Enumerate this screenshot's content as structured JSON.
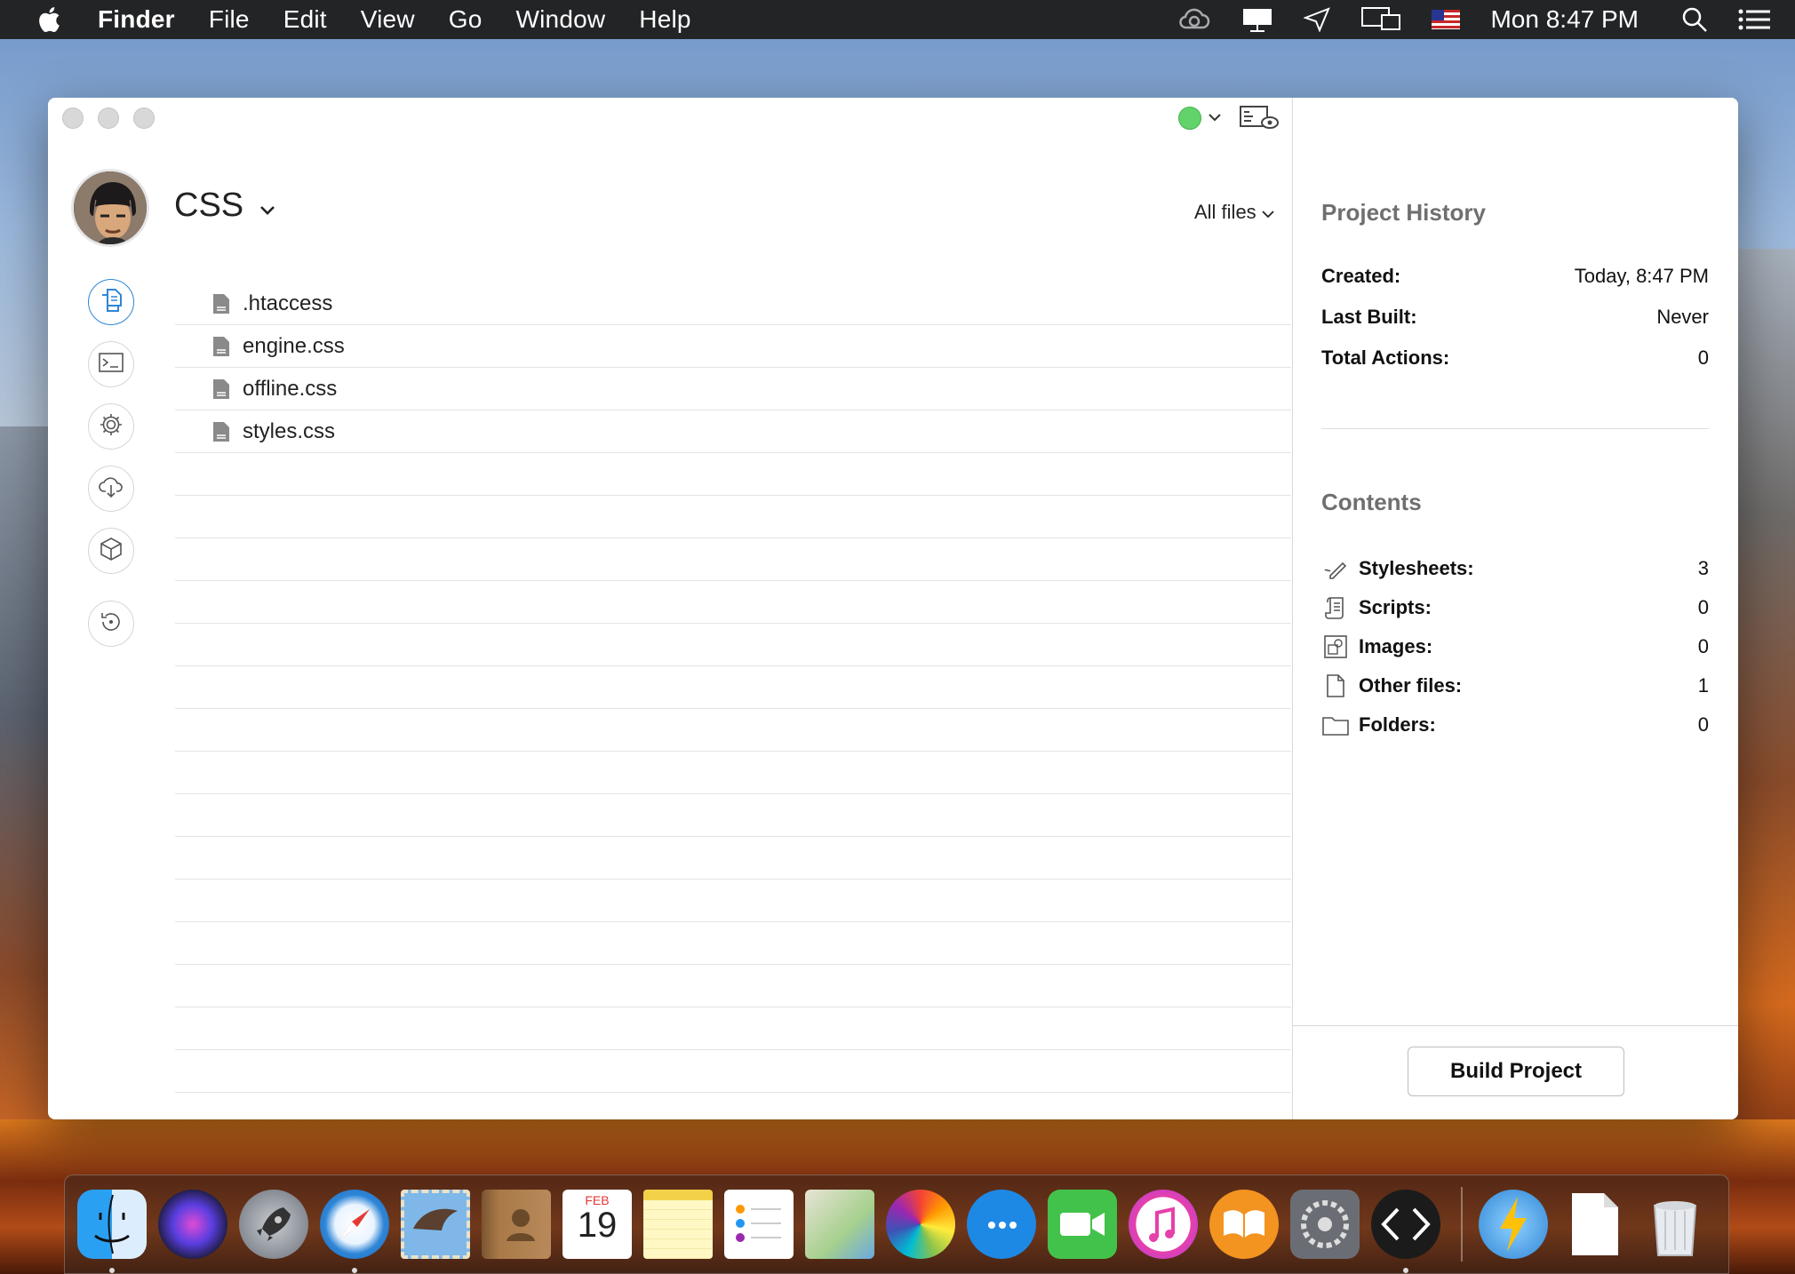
{
  "menubar": {
    "app_name": "Finder",
    "menus": [
      "File",
      "Edit",
      "View",
      "Go",
      "Window",
      "Help"
    ],
    "clock": "Mon 8:47 PM"
  },
  "window": {
    "project_name": "CSS",
    "filter_label": "All files",
    "status_color": "#62d36b",
    "files": [
      ".htaccess",
      "engine.css",
      "offline.css",
      "styles.css"
    ],
    "nav_items": [
      "files-icon",
      "terminal-icon",
      "settings-icon",
      "cloud-download-icon",
      "package-icon",
      "history-icon"
    ]
  },
  "sidebar": {
    "history_title": "Project History",
    "history": [
      {
        "label": "Created:",
        "value": "Today, 8:47 PM"
      },
      {
        "label": "Last Built:",
        "value": "Never"
      },
      {
        "label": "Total Actions:",
        "value": "0"
      }
    ],
    "contents_title": "Contents",
    "contents": [
      {
        "label": "Stylesheets:",
        "value": "3",
        "icon": "stylesheet-icon"
      },
      {
        "label": "Scripts:",
        "value": "0",
        "icon": "script-icon"
      },
      {
        "label": "Images:",
        "value": "0",
        "icon": "image-icon"
      },
      {
        "label": "Other files:",
        "value": "1",
        "icon": "file-icon"
      },
      {
        "label": "Folders:",
        "value": "0",
        "icon": "folder-icon"
      }
    ],
    "build_button": "Build Project"
  },
  "dock": {
    "calendar_month": "FEB",
    "calendar_day": "19",
    "apps": [
      "finder",
      "siri",
      "launchpad",
      "safari",
      "mail",
      "contacts",
      "calendar",
      "notes",
      "reminders",
      "maps",
      "photos",
      "messages",
      "facetime",
      "itunes",
      "ibooks",
      "system-preferences",
      "coda",
      "downloads",
      "document",
      "trash"
    ]
  }
}
